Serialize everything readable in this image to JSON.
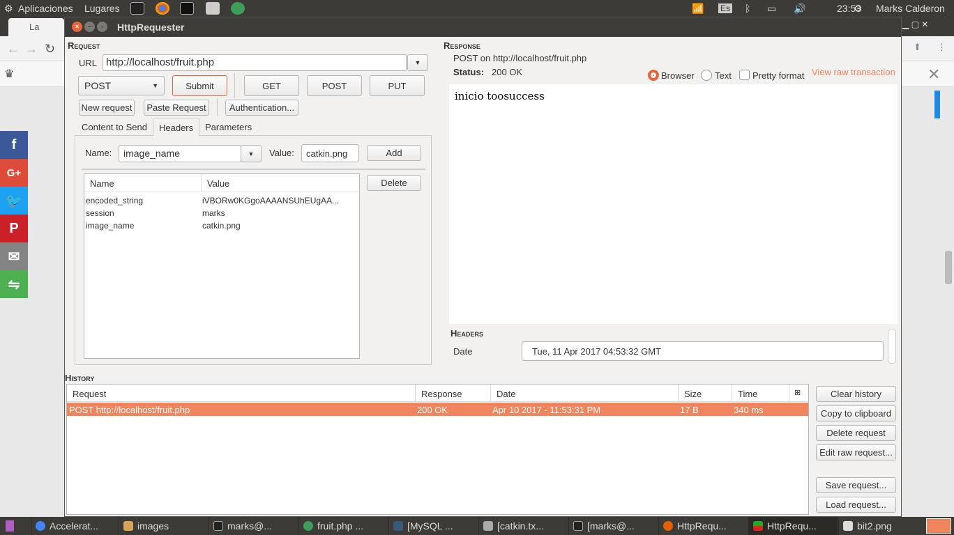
{
  "topbar": {
    "apps": "Aplicaciones",
    "places": "Lugares",
    "keyboard": "Es",
    "time": "23:53",
    "user": "Marks Calderon"
  },
  "browser": {
    "tab": "La"
  },
  "window": {
    "title": "HttpRequester"
  },
  "request": {
    "heading": "Request",
    "url_label": "URL",
    "url": "http://localhost/fruit.php",
    "method": "POST",
    "submit": "Submit",
    "get": "GET",
    "post": "POST",
    "put": "PUT",
    "new_request": "New request",
    "paste_request": "Paste Request",
    "authentication": "Authentication...",
    "tabs": [
      "Content to Send",
      "Headers",
      "Parameters"
    ],
    "name_label": "Name:",
    "name_value": "image_name",
    "value_label": "Value:",
    "value_value": "catkin.png",
    "add": "Add",
    "delete": "Delete",
    "columns": [
      "Name",
      "Value"
    ],
    "rows": [
      [
        "encoded_string",
        "iVBORw0KGgoAAAANSUhEUgAA..."
      ],
      [
        "session",
        "marks"
      ],
      [
        "image_name",
        "catkin.png"
      ]
    ]
  },
  "response": {
    "heading": "Response",
    "summary": "POST on http://localhost/fruit.php",
    "status_label": "Status:",
    "status": "200 OK",
    "browser": "Browser",
    "text": "Text",
    "pretty": "Pretty format",
    "raw": "View raw transaction",
    "body": "inicio toosuccess",
    "headers_heading": "Headers",
    "header_name": "Date",
    "header_value": "Tue, 11 Apr 2017 04:53:32 GMT",
    "selected_view": "Browser",
    "pretty_checked": false
  },
  "history": {
    "heading": "History",
    "columns": [
      "Request",
      "Response",
      "Date",
      "Size",
      "Time"
    ],
    "rows": [
      [
        "POST http://localhost/fruit.php",
        "200 OK",
        "Apr 10 2017 - 11:53:31 PM",
        "17 B",
        "340 ms"
      ]
    ],
    "buttons": [
      "Clear history",
      "Copy to clipboard",
      "Delete request",
      "Edit raw request...",
      "Save request...",
      "Load request..."
    ]
  },
  "taskbar": [
    "Accelerat...",
    "images",
    "marks@...",
    "fruit.php ...",
    "[MySQL ...",
    "[catkin.tx...",
    "[marks@...",
    "HttpRequ...",
    "HttpRequ...",
    "bit2.png"
  ],
  "colors": {
    "accent": "#f0845c",
    "selected_row": "#f0845c"
  }
}
